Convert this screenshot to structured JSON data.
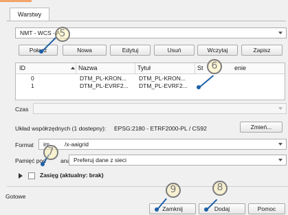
{
  "tabs": [
    "Warstwy"
  ],
  "connection_combo": {
    "value": "NMT - WCS - A"
  },
  "buttons": {
    "connect": "Połącz",
    "new": "Nowa",
    "edit": "Edytuj",
    "delete": "Usuń",
    "load": "Wczytaj",
    "save": "Zapisz",
    "change": "Zmień...",
    "close": "Zamknij",
    "add": "Dodaj",
    "help": "Pomoc"
  },
  "table": {
    "headers": {
      "id": "ID",
      "name": "Nazwa",
      "title": "Tytuł",
      "status": "St",
      "status_tail": "enie"
    },
    "rows": [
      {
        "id": "0",
        "name": "DTM_PL-KRON...",
        "title": "DTM_PL-KRON..."
      },
      {
        "id": "1",
        "name": "DTM_PL-EVRF2...",
        "title": "DTM_PL-EVRF2..."
      }
    ]
  },
  "time_label": "Czas",
  "crs": {
    "label": "Układ współrzędnych (1 dostepny):",
    "value": "EPSG:2180 - ETRF2000-PL / CS92"
  },
  "format": {
    "label": "Format",
    "prefix": "im",
    "value": "/x-aaigrid"
  },
  "cache": {
    "label": "Pamięć pod",
    "label_tail": "ana",
    "value": "Preferuj dane z sieci"
  },
  "extent_label": "Zasięg (aktualny: brak)",
  "status": "Gotowe",
  "markers": [
    "5",
    "6",
    "7",
    "8",
    "9"
  ],
  "colors": {
    "accent": "#1d5fa8",
    "marker_ring": "#7a7a7a",
    "tab_highlight": "#f2a46a"
  }
}
